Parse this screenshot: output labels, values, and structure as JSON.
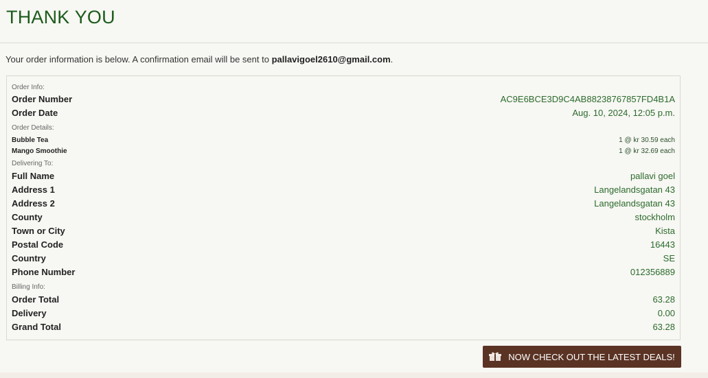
{
  "page": {
    "title": "THANK YOU",
    "intro_text": "Your order information is below. A confirmation email will be sent to ",
    "email": "pallavigoel2610@gmail.com",
    "intro_end": "."
  },
  "order_info": {
    "heading": "Order Info:",
    "number_label": "Order Number",
    "number_value": "AC9E6BCE3D9C4AB88238767857FD4B1A",
    "date_label": "Order Date",
    "date_value": "Aug. 10, 2024, 12:05 p.m."
  },
  "order_details": {
    "heading": "Order Details:",
    "items": [
      {
        "name": "Bubble Tea",
        "qty_price": "1 @ kr 30.59 each"
      },
      {
        "name": "Mango Smoothie",
        "qty_price": "1 @ kr 32.69 each"
      }
    ]
  },
  "delivery": {
    "heading": "Delivering To:",
    "fields": [
      {
        "label": "Full Name",
        "value": "pallavi goel"
      },
      {
        "label": "Address 1",
        "value": "Langelandsgatan 43"
      },
      {
        "label": "Address 2",
        "value": "Langelandsgatan 43"
      },
      {
        "label": "County",
        "value": "stockholm"
      },
      {
        "label": "Town or City",
        "value": "Kista"
      },
      {
        "label": "Postal Code",
        "value": "16443"
      },
      {
        "label": "Country",
        "value": "SE"
      },
      {
        "label": "Phone Number",
        "value": "012356889"
      }
    ]
  },
  "billing": {
    "heading": "Billing Info:",
    "fields": [
      {
        "label": "Order Total",
        "value": "63.28"
      },
      {
        "label": "Delivery",
        "value": "0.00"
      },
      {
        "label": "Grand Total",
        "value": "63.28"
      }
    ]
  },
  "cta": {
    "label": "NOW CHECK OUT THE LATEST DEALS!",
    "icon": "gift-icon"
  },
  "colors": {
    "title_green": "#1d5c1d",
    "value_green": "#2c6b2c",
    "button_brown": "#5a3324",
    "background": "#f7f7f3"
  }
}
